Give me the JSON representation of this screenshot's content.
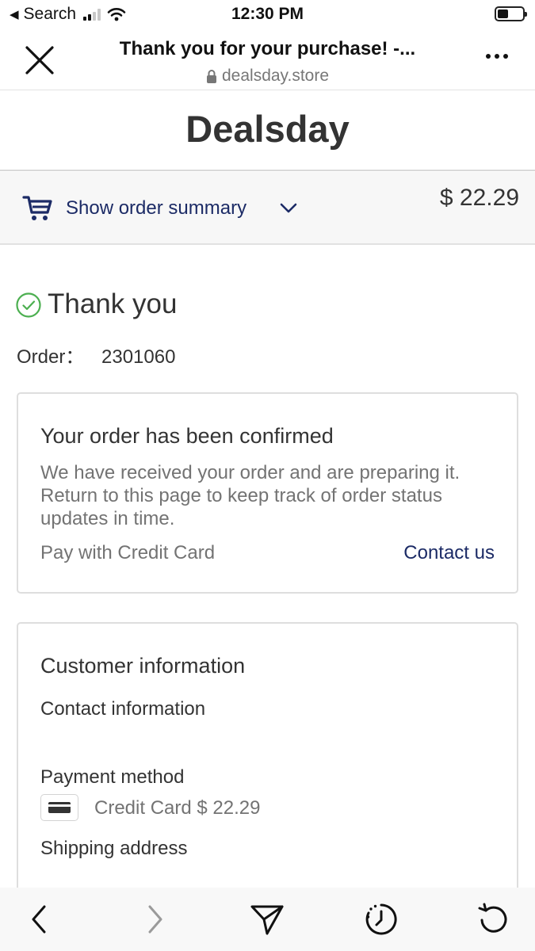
{
  "status_bar": {
    "back_app": "Search",
    "time": "12:30 PM"
  },
  "browser": {
    "page_title": "Thank you for your purchase! -...",
    "url": "dealsday.store"
  },
  "store": {
    "name": "Dealsday"
  },
  "order_summary": {
    "toggle_label": "Show order summary",
    "total": "$ 22.29"
  },
  "thank_you": {
    "heading": "Thank you",
    "order_label": "Order：",
    "order_number": "2301060"
  },
  "confirmation": {
    "title": "Your order has been confirmed",
    "body": "We have received your order and are preparing it. Return to this page to keep track of order status updates in time.",
    "payment_note": "Pay with Credit Card",
    "contact_link": "Contact us"
  },
  "customer_info": {
    "title": "Customer information",
    "contact_label": "Contact information",
    "payment_label": "Payment method",
    "payment_value": "Credit Card $ 22.29",
    "shipping_label": "Shipping address"
  },
  "colors": {
    "accent_navy": "#1c2b66",
    "success_green": "#4caf50",
    "muted_text": "#737373"
  },
  "icons": [
    "close-icon",
    "lock-icon",
    "more-icon",
    "cart-icon",
    "chevron-down-icon",
    "check-circle-icon",
    "credit-card-icon",
    "back-arrow-icon",
    "forward-arrow-icon",
    "share-icon",
    "history-icon",
    "reload-icon"
  ]
}
